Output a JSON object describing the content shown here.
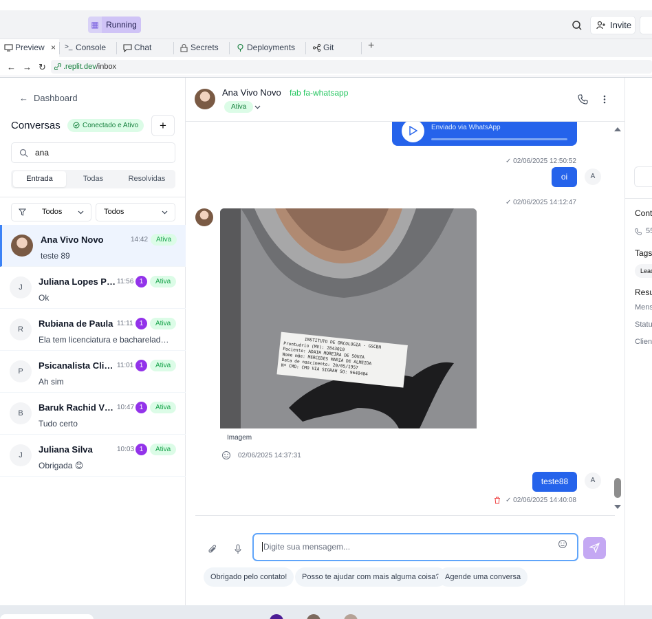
{
  "replit": {
    "run_label": "Running",
    "invite_label": "Invite",
    "tabs": [
      {
        "label": "Preview",
        "close": "×"
      },
      {
        "label": "Console"
      },
      {
        "label": "Chat"
      },
      {
        "label": "Secrets"
      },
      {
        "label": "Deployments"
      },
      {
        "label": "Git"
      }
    ],
    "url_host": ".replit.dev",
    "url_path": "/inbox"
  },
  "sidebar": {
    "back_label": "Dashboard",
    "title": "Conversas",
    "connection_status": "Conectado e Ativo",
    "search_value": "ana",
    "segments": [
      "Entrada",
      "Todas",
      "Resolvidas"
    ],
    "filters": [
      "Todos",
      "Todos"
    ],
    "conversations": [
      {
        "initial": "",
        "name": "Ana Vivo Novo",
        "time": "14:42",
        "badge": "",
        "status": "Ativa",
        "last_message": "teste 89"
      },
      {
        "initial": "J",
        "name": "Juliana Lopes Psi...",
        "time": "11:56",
        "badge": "1",
        "status": "Ativa",
        "last_message": "Ok"
      },
      {
        "initial": "R",
        "name": "Rubiana de Paula",
        "time": "11:11",
        "badge": "1",
        "status": "Ativa",
        "last_message": "Ela tem licenciatura e bacharelado e..."
      },
      {
        "initial": "P",
        "name": "Psicanalista Clini...",
        "time": "11:01",
        "badge": "1",
        "status": "Ativa",
        "last_message": "Ah sim"
      },
      {
        "initial": "B",
        "name": "Baruk Rachid Via...",
        "time": "10:47",
        "badge": "1",
        "status": "Ativa",
        "last_message": "Tudo certo"
      },
      {
        "initial": "J",
        "name": "Juliana Silva",
        "time": "10:03",
        "badge": "1",
        "status": "Ativa",
        "last_message": "Obrigada 😊"
      }
    ]
  },
  "chat": {
    "contact_name": "Ana Vivo Novo",
    "channel_text": "fab fa-whatsapp",
    "status": "Ativa",
    "audio_caption": "Enviado via WhatsApp",
    "messages": [
      {
        "text": "",
        "meta": "✓ 02/06/2025 12:50:52"
      },
      {
        "text": "oi",
        "meta": "✓ 02/06/2025 14:12:47",
        "avatar": "A"
      },
      {
        "text": "Imagem",
        "meta": "02/06/2025 14:37:31"
      },
      {
        "text": "teste88",
        "meta": "✓ 02/06/2025 14:40:08",
        "avatar": "A"
      }
    ],
    "image_label_lines": [
      "INSTITUTO DE ONCOLOGIA - GSCBH",
      "Prontuário (MV): 2843010",
      "Paciente: ADAIR MOREIRA DE SOUZA",
      "Nome mãe: MERCEDES MARIA DE ALMEIDA",
      "Data de nascimento: 20/05/1957",
      "Nº CMO: CMO VIA SIGRAH SO: 9648404"
    ],
    "composer_placeholder": "Digite sua mensagem...",
    "quick_replies": [
      "Obrigado pelo contato!",
      "Posso te ajudar com mais alguma coisa?",
      "Agende uma conversa"
    ]
  },
  "right_panel": {
    "contact_heading": "Cont",
    "phone_partial": "55",
    "tags_heading": "Tags",
    "tag_partial": "Lead",
    "summary_heading": "Resu",
    "rows": [
      "Mens",
      "Statu",
      "Clien"
    ]
  }
}
